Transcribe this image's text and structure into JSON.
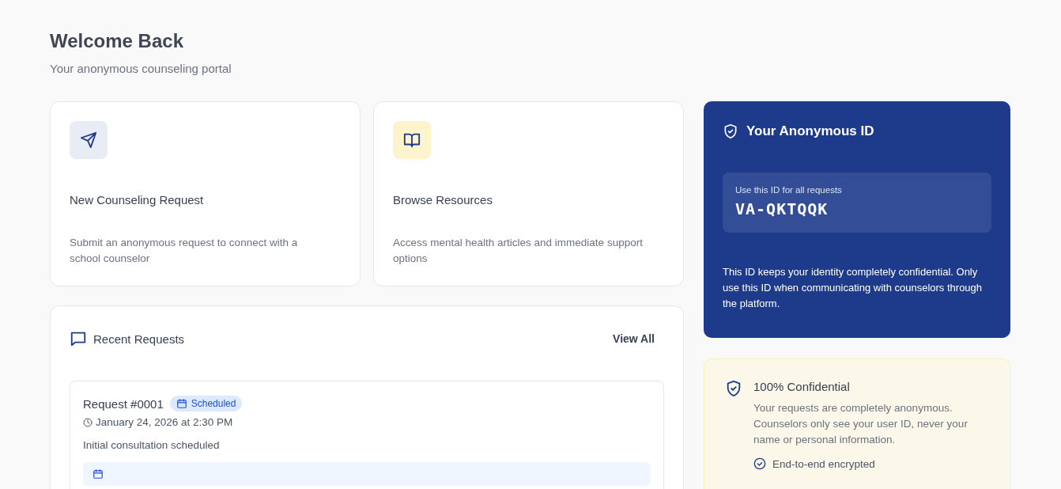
{
  "header": {
    "title": "Welcome Back",
    "subtitle": "Your anonymous counseling portal"
  },
  "actions": [
    {
      "kind": "send",
      "title": "New Counseling Request",
      "description": "Submit an anonymous request to connect with a school counselor"
    },
    {
      "kind": "book",
      "title": "Browse Resources",
      "description": "Access mental health articles and immediate support options"
    }
  ],
  "recent": {
    "title": "Recent Requests",
    "link": "View All",
    "requests": [
      {
        "title": "Request #0001",
        "status": "Scheduled",
        "datetime": "January 24, 2026 at 2:30 PM",
        "note": "Initial consultation scheduled"
      }
    ]
  },
  "id_card": {
    "title": "Your Anonymous ID",
    "hint": "Use this ID for all requests",
    "id": "VA-QKTQQK",
    "description": "This ID keeps your identity completely confidential. Only use this ID when communicating with counselors through the platform."
  },
  "privacy": {
    "title": "100% Confidential",
    "description": "Your requests are completely anonymous. Counselors only see your user ID, never your name or personal information.",
    "features": [
      "End-to-end encrypted"
    ]
  }
}
